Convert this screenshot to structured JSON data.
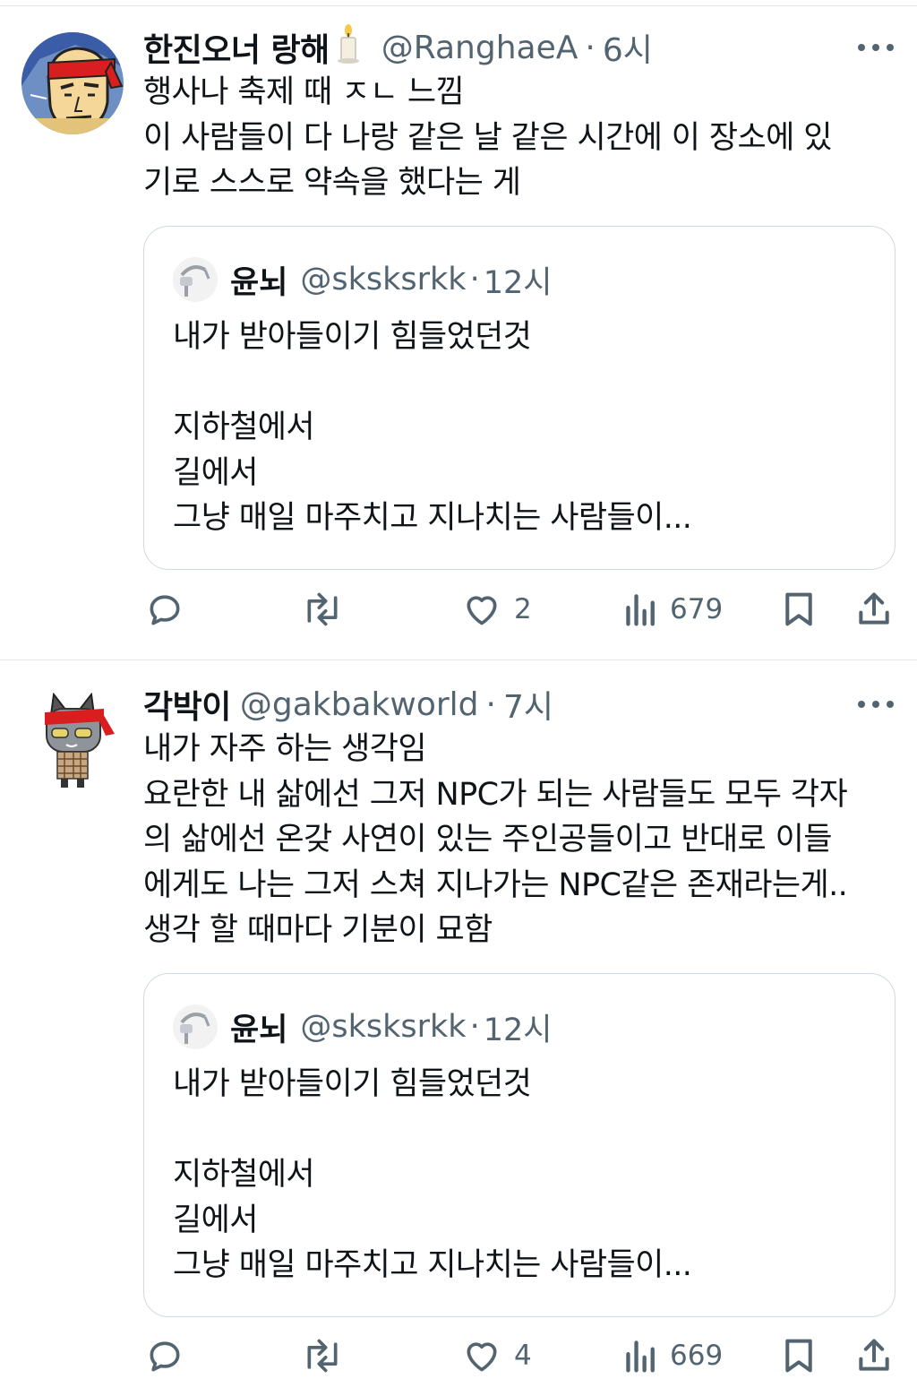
{
  "tweets": [
    {
      "name": "한진오너 랑해",
      "name_emoji": "candle",
      "handle": "@RanghaeA",
      "separator": "·",
      "time": "6시",
      "avatar_icon": "red-headband-character",
      "text_lines": [
        "행사나 축제 때 ㅈㄴ 느낌",
        "이 사람들이 다 나랑 같은 날 같은 시간에 이 장소에 있",
        "기로 스스로 약속을 했다는 게"
      ],
      "quote": {
        "name": "윤뇌",
        "handle": "@sksksrkk",
        "separator": "·",
        "time": "12시",
        "avatar_icon": "sink-faucet",
        "text_lines": [
          "내가 받아들이기 힘들었던것",
          "",
          "지하철에서",
          "길에서",
          "그냥 매일 마주치고 지나치는 사람들이..."
        ]
      },
      "actions": {
        "reply_count": "",
        "retweet_count": "",
        "like_count": "2",
        "view_count": "679"
      }
    },
    {
      "name": "각박이",
      "handle": "@gakbakworld",
      "separator": "·",
      "time": "7시",
      "avatar_icon": "cat-with-headband",
      "text_lines": [
        "내가 자주 하는 생각임",
        "요란한 내 삶에선 그저 NPC가 되는 사람들도 모두 각자",
        "의 삶에선 온갖 사연이 있는 주인공들이고 반대로 이들",
        "에게도 나는 그저 스쳐 지나가는 NPC같은 존재라는게..",
        "생각 할 때마다 기분이 묘함"
      ],
      "quote": {
        "name": "윤뇌",
        "handle": "@sksksrkk",
        "separator": "·",
        "time": "12시",
        "avatar_icon": "sink-faucet",
        "text_lines": [
          "내가 받아들이기 힘들었던것",
          "",
          "지하철에서",
          "길에서",
          "그냥 매일 마주치고 지나치는 사람들이..."
        ]
      },
      "actions": {
        "reply_count": "",
        "retweet_count": "",
        "like_count": "4",
        "view_count": "669"
      }
    }
  ],
  "colors": {
    "text": "#0f1419",
    "secondary": "#536471",
    "border": "#cfd9de",
    "headband": "#d81e1e"
  }
}
